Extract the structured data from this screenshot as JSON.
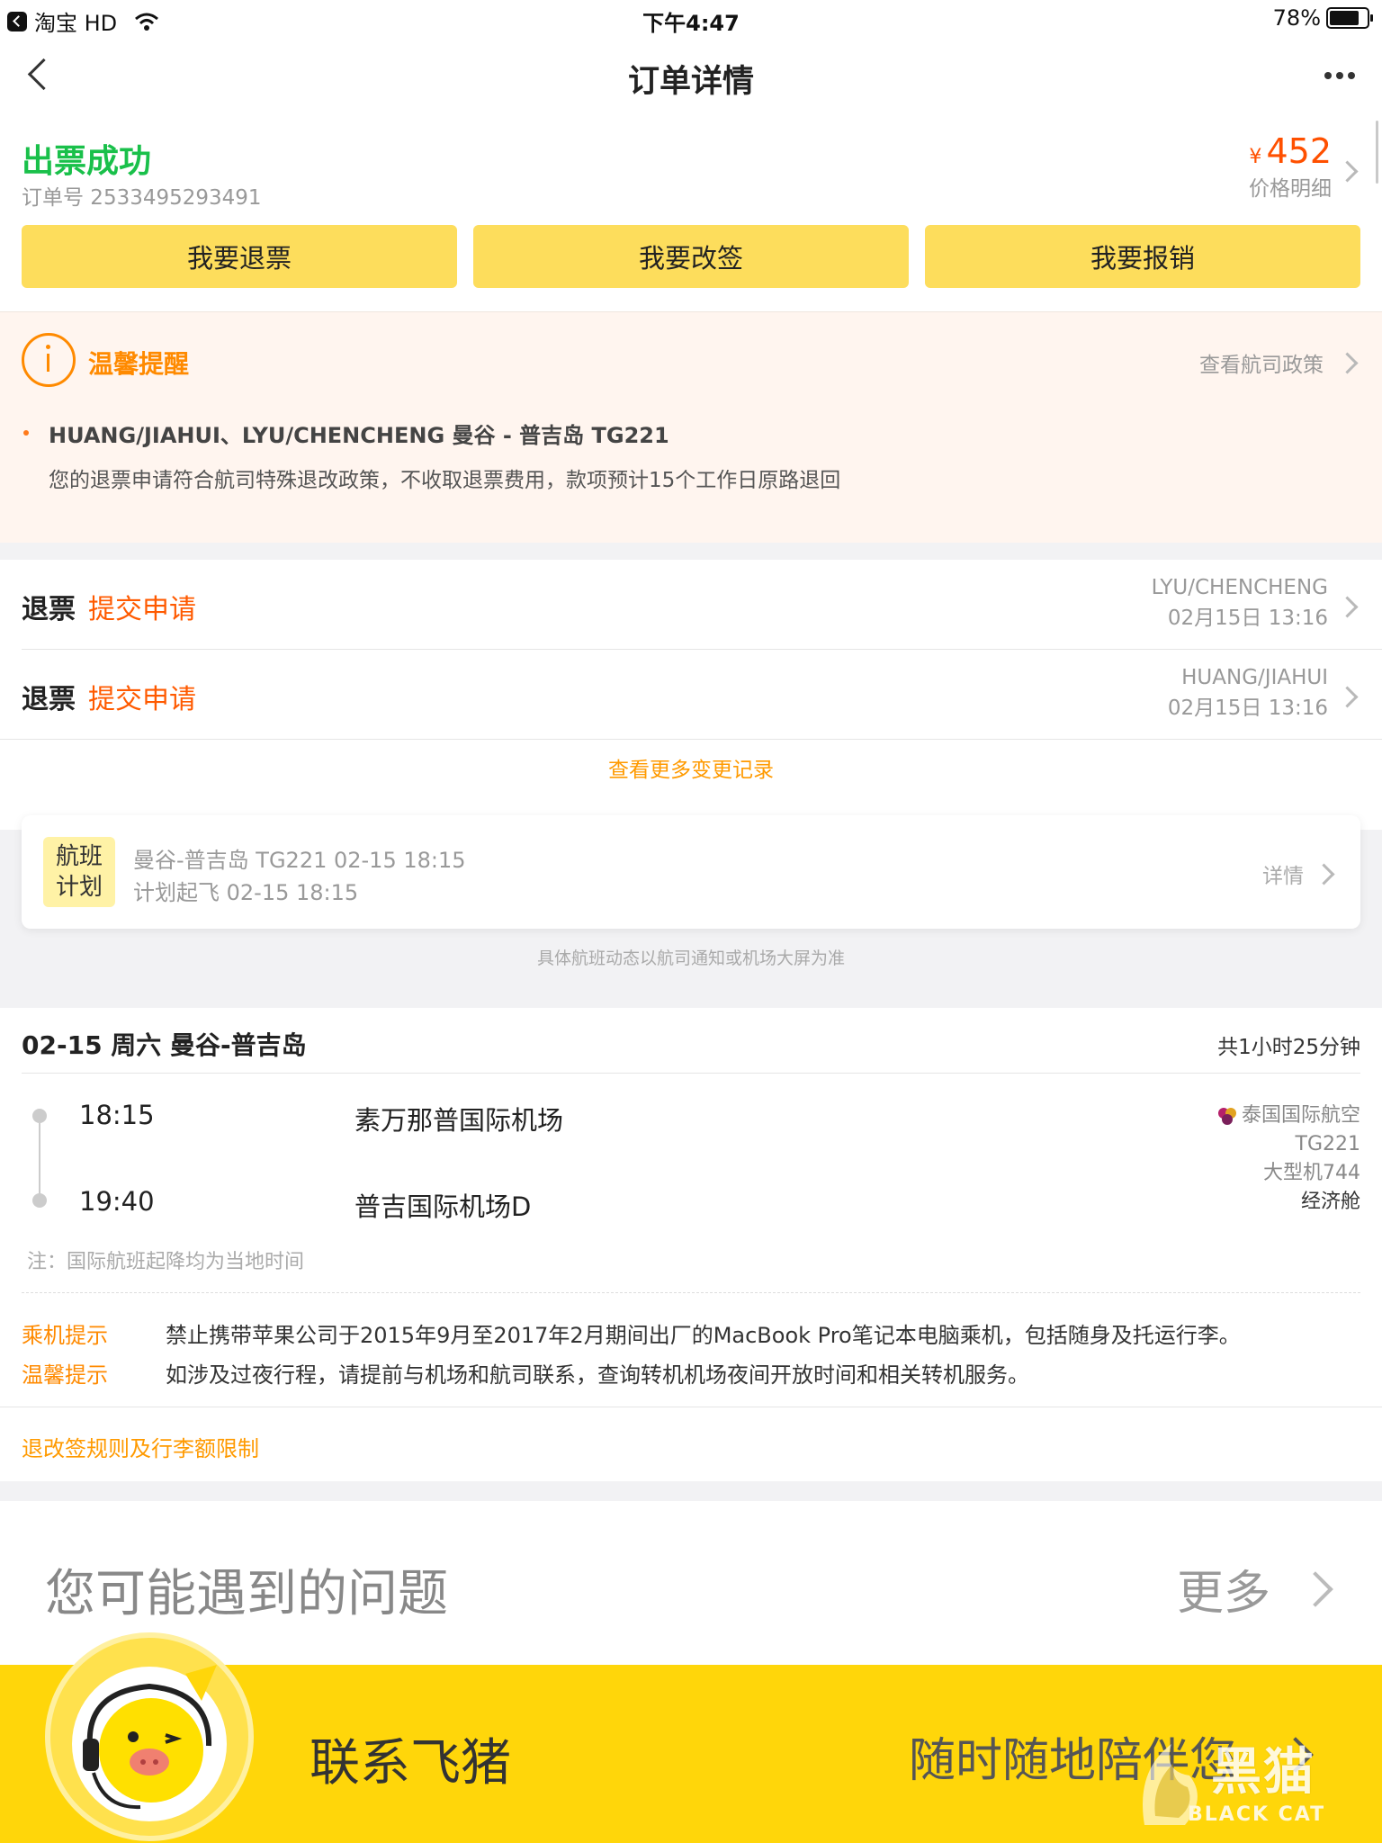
{
  "status_bar": {
    "back_app": "淘宝 HD",
    "time": "下午4:47",
    "battery": "78%"
  },
  "nav": {
    "title": "订单详情"
  },
  "order": {
    "status": "出票成功",
    "order_no": "订单号 2533495293491",
    "currency": "¥",
    "price": "452",
    "price_detail": "价格明细"
  },
  "actions": {
    "refund": "我要退票",
    "change": "我要改签",
    "reimburse": "我要报销"
  },
  "reminder": {
    "title": "温馨提醒",
    "policy_link": "查看航司政策",
    "passengers_route": "HUANG/JIAHUI、LYU/CHENCHENG 曼谷 - 普吉岛 TG221",
    "message": "您的退票申请符合航司特殊退改政策，不收取退票费用，款项预计15个工作日原路退回"
  },
  "refund_records": [
    {
      "type": "退票",
      "status": "提交申请",
      "passenger": "LYU/CHENCHENG",
      "time": "02月15日 13:16"
    },
    {
      "type": "退票",
      "status": "提交申请",
      "passenger": "HUANG/JIAHUI",
      "time": "02月15日 13:16"
    }
  ],
  "more_records": "查看更多变更记录",
  "flight_plan": {
    "badge_line1": "航班",
    "badge_line2": "计划",
    "line1": "曼谷-普吉岛 TG221 02-15 18:15",
    "line2": "计划起飞 02-15 18:15",
    "details": "详情",
    "notice": "具体航班动态以航司通知或机场大屏为准"
  },
  "itinerary": {
    "header": "02-15 周六 曼谷-普吉岛",
    "duration": "共1小时25分钟",
    "depart_time": "18:15",
    "depart_airport": "素万那普国际机场",
    "arrive_time": "19:40",
    "arrive_airport": "普吉国际机场D",
    "airline": "泰国国际航空",
    "flight_no": "TG221",
    "aircraft": "大型机744",
    "cabin": "经济舱",
    "note": "注：国际航班起降均为当地时间"
  },
  "tips": [
    {
      "key": "乘机提示",
      "text": "禁止携带苹果公司于2015年9月至2017年2月期间出厂的MacBook Pro笔记本电脑乘机，包括随身及托运行李。"
    },
    {
      "key": "温馨提示",
      "text": "如涉及过夜行程，请提前与机场和航司联系，查询转机机场夜间开放时间和相关转机服务。"
    }
  ],
  "rules_link": "退改签规则及行李额限制",
  "faq": {
    "title": "您可能遇到的问题",
    "more": "更多"
  },
  "contact": {
    "title": "联系飞猪",
    "slogan": "随时随地陪伴您"
  },
  "watermark": {
    "cn": "黑猫",
    "en": "BLACK CAT"
  },
  "colors": {
    "success": "#19c04a",
    "price": "#ff5000",
    "button_yellow": "#fddd5c",
    "accent_orange": "#ff8a00",
    "banner_yellow": "#ffd60a"
  }
}
